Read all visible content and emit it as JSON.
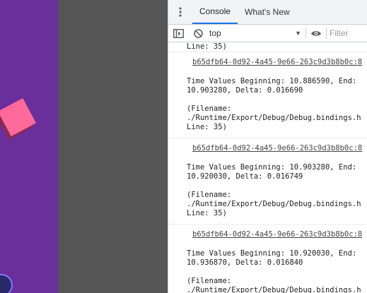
{
  "devtools": {
    "tabs": [
      "Console",
      "What's New"
    ],
    "context": "top",
    "filter_placeholder": "Filter"
  },
  "console": {
    "partial_line": "Line: 35)",
    "messages": [
      {
        "source": "b65dfb64-0d92-4a45-9e66-263c9d3b8b0c:8",
        "line1": "Time Values Beginning: 10.886590, End:",
        "line2": "10.903280, Delta: 0.016690",
        "file1": "(Filename:",
        "file2": "./Runtime/Export/Debug/Debug.bindings.h",
        "file3": "Line: 35)"
      },
      {
        "source": "b65dfb64-0d92-4a45-9e66-263c9d3b8b0c:8",
        "line1": "Time Values Beginning: 10.903280, End:",
        "line2": "10.920030, Delta: 0.016749",
        "file1": "(Filename:",
        "file2": "./Runtime/Export/Debug/Debug.bindings.h",
        "file3": "Line: 35)"
      },
      {
        "source": "b65dfb64-0d92-4a45-9e66-263c9d3b8b0c:8",
        "line1": "Time Values Beginning: 10.920030, End:",
        "line2": "10.936870, Delta: 0.016840",
        "file1": "(Filename:",
        "file2": "./Runtime/Export/Debug/Debug.bindings.h",
        "file3": ""
      }
    ]
  },
  "colors": {
    "stage_background": "#6a2f9a",
    "cube": "#ff6a9a",
    "tab_active_underline": "#1a73e8"
  },
  "icons": [
    "kebab-menu-icon",
    "sidebar-toggle-icon",
    "clear-console-icon",
    "eye-icon"
  ]
}
